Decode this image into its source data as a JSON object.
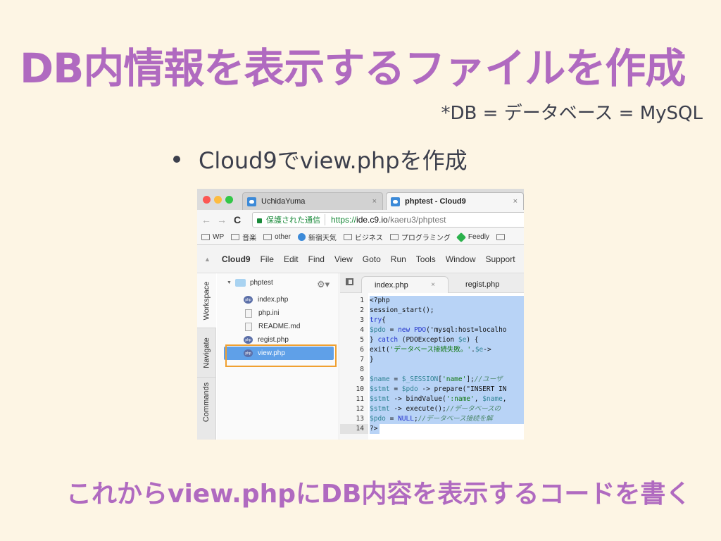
{
  "slide": {
    "title": "DB内情報を表示するファイルを作成",
    "footnote": "*DB = データベース = MySQL",
    "bullet": "Cloud9でview.phpを作成",
    "bottom_note": "これからview.phpにDB内容を表示するコードを書く",
    "colors": {
      "accent": "#b06ac0",
      "text": "#3c3f4c",
      "background": "#fdf5e4",
      "highlight": "#f0a030"
    }
  },
  "browser": {
    "tabs": [
      {
        "label": "UchidaYuma",
        "icon": "cloud9-favicon",
        "active": false
      },
      {
        "label": "phptest - Cloud9",
        "icon": "cloud9-favicon",
        "active": true
      }
    ],
    "close_glyph": "×",
    "nav": {
      "back": "←",
      "forward": "→",
      "reload": "C"
    },
    "address": {
      "security_label": "保護された通信",
      "scheme": "https://",
      "host": "ide.c9.io",
      "path": "/kaeru3/phptest"
    },
    "bookmarks": [
      {
        "label": "WP",
        "icon": "folder-icon"
      },
      {
        "label": "音楽",
        "icon": "folder-icon"
      },
      {
        "label": "other",
        "icon": "folder-icon"
      },
      {
        "label": "新宿天気",
        "icon": "weather-icon"
      },
      {
        "label": "ビジネス",
        "icon": "folder-icon"
      },
      {
        "label": "プログラミング",
        "icon": "folder-icon"
      },
      {
        "label": "Feedly",
        "icon": "feedly-icon"
      }
    ]
  },
  "ide": {
    "menu_toggle": "▲",
    "menu": [
      "Cloud9",
      "File",
      "Edit",
      "Find",
      "View",
      "Goto",
      "Run",
      "Tools",
      "Window",
      "Support"
    ],
    "side_tabs": [
      "Workspace",
      "Navigate",
      "Commands"
    ],
    "tree": {
      "root": "phptest",
      "gear": "⚙▾",
      "files": [
        {
          "name": "index.php",
          "type": "php"
        },
        {
          "name": "php.ini",
          "type": "text"
        },
        {
          "name": "README.md",
          "type": "text"
        },
        {
          "name": "regist.php",
          "type": "php"
        },
        {
          "name": "view.php",
          "type": "php",
          "selected": true
        }
      ]
    },
    "editor_tabs": [
      {
        "label": "index.php",
        "active": true,
        "close": "×"
      },
      {
        "label": "regist.php",
        "active": false
      }
    ],
    "code_lines": [
      "<?php",
      "session_start();",
      "try{",
      "$pdo = new PDO('mysql:host=localho",
      "} catch (PDOException $e) {",
      "exit('データベース接続失敗。'.$e->",
      "}",
      "",
      "$name = $_SESSION['name'];//ユーザ",
      "$stmt = $pdo -> prepare(\"INSERT IN",
      "$stmt -> bindValue(':name', $name,",
      "$stmt -> execute();//データベースの",
      "$pdo = NULL;//データベース接続を解",
      "?>"
    ],
    "line_numbers": [
      "1",
      "2",
      "3",
      "4",
      "5",
      "6",
      "7",
      "8",
      "9",
      "10",
      "11",
      "12",
      "13",
      "14"
    ],
    "active_line": "14"
  }
}
